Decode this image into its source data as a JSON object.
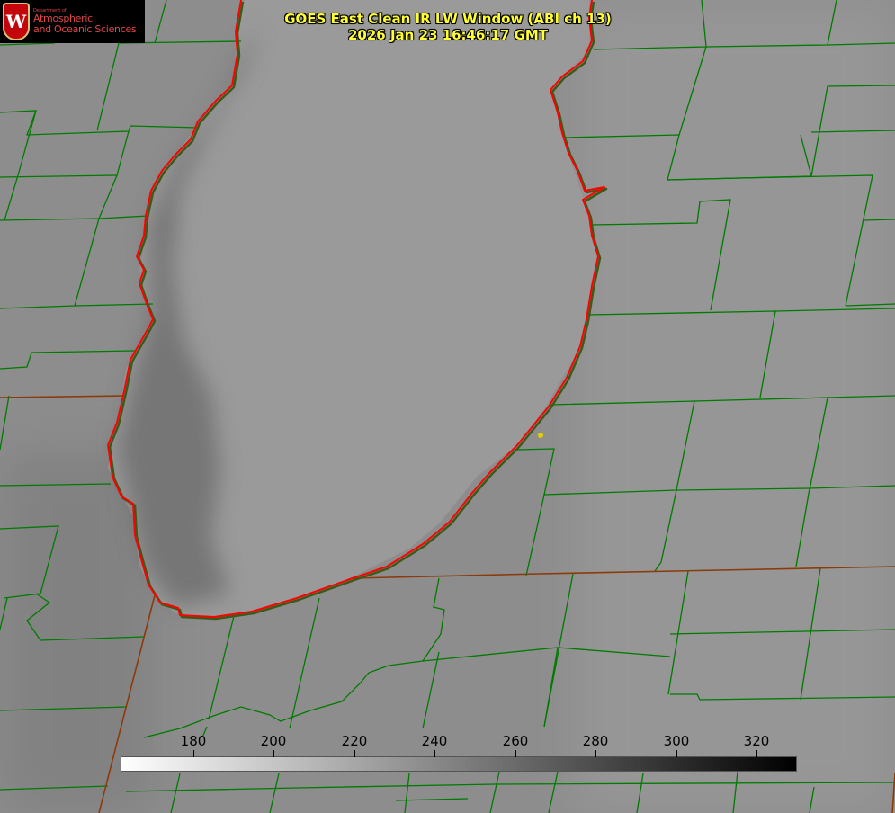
{
  "product": {
    "title_line1": "GOES East Clean IR LW Window (ABI ch 13)",
    "title_line2": "2026 Jan 23 16:46:17 GMT",
    "title_color": "#ffff33"
  },
  "logo": {
    "department_label": "Department of",
    "line1": "Atmospheric",
    "line2": "and Oceanic Sciences",
    "crest_letter": "W",
    "crest_color": "#c5050c",
    "text_color": "#e0464a"
  },
  "colorbar": {
    "min": 162,
    "max": 330,
    "start_color": "#ffffff",
    "end_color": "#000000",
    "tick_labels": [
      "180",
      "200",
      "220",
      "240",
      "260",
      "280",
      "300",
      "320"
    ],
    "tick_values": [
      180,
      200,
      220,
      240,
      260,
      280,
      300,
      320
    ]
  },
  "map": {
    "county_line_color": "#007a00",
    "state_line_color": "#8b3a0a",
    "coastline_color": "#ff0000",
    "marker_color": "#e0d000"
  }
}
